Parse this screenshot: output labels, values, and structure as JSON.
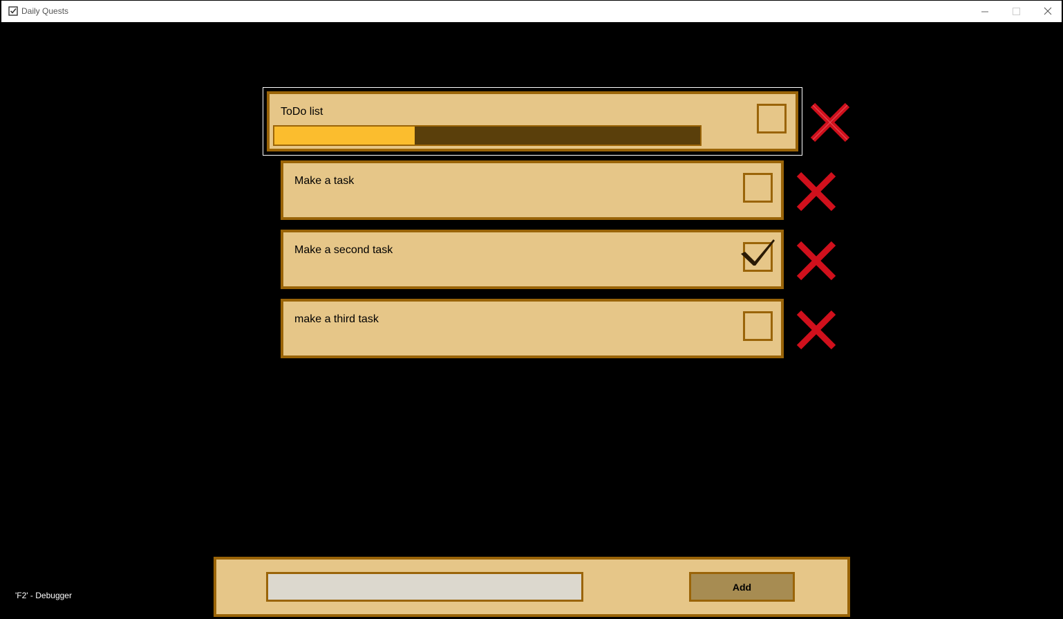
{
  "window": {
    "title": "Daily Quests"
  },
  "main_task": {
    "label": "ToDo list",
    "checked": false,
    "progress_fraction": 0.33
  },
  "subtasks": [
    {
      "label": "Make a task",
      "checked": false
    },
    {
      "label": "Make a second task",
      "checked": true
    },
    {
      "label": "make a third task",
      "checked": false
    }
  ],
  "add_bar": {
    "input_value": "",
    "button_label": "Add"
  },
  "debug_hint": "'F2' - Debugger",
  "colors": {
    "panel_fill": "#e6c688",
    "panel_border": "#9a6408",
    "progress_fill": "#fbbd2e",
    "progress_track": "#5a3f0b",
    "delete_red": "#d0101c"
  }
}
